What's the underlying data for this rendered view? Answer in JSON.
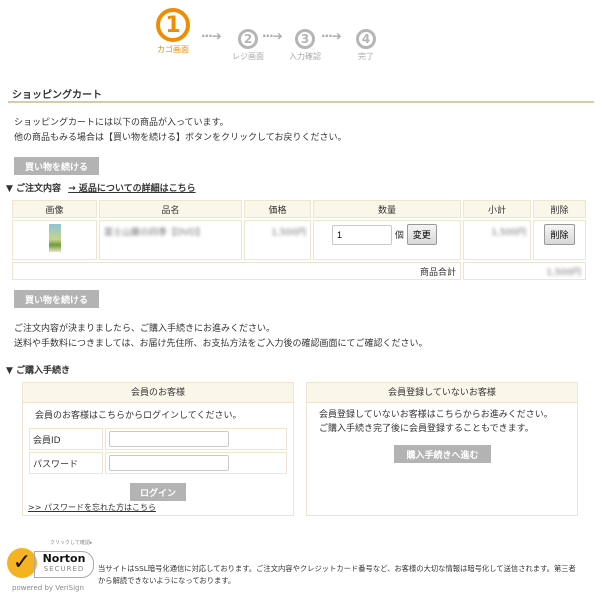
{
  "steps": [
    {
      "num": "1",
      "label": "カゴ画面",
      "active": true
    },
    {
      "num": "2",
      "label": "レジ画面"
    },
    {
      "num": "3",
      "label": "入力確認"
    },
    {
      "num": "4",
      "label": "完了"
    }
  ],
  "accent": "#f08c00",
  "page_title": "ショッピングカート",
  "intro": [
    "ショッピングカートには以下の商品が入っています。",
    "他の商品もみる場合は【買い物を続ける】ボタンをクリックしてお戻りください。"
  ],
  "continue_label": "買い物を続ける",
  "order": {
    "heading": "▼ ご注文内容",
    "return_link": "→ 返品についての詳細はこちら",
    "columns": [
      "画像",
      "品名",
      "価格",
      "数量",
      "小計",
      "削除"
    ],
    "items": [
      {
        "name": "富士山麓の四季【DVD】",
        "price": "1,500円",
        "quantity": "1",
        "unit": "個",
        "change_label": "変更",
        "subtotal": "1,500円",
        "delete_label": "削除"
      }
    ],
    "total_label": "商品合計",
    "total": "1,500円"
  },
  "notes": [
    "ご注文内容が決まりましたら、ご購入手続きにお進みください。",
    "送料や手数料につきましては、お届け先住所、お支払方法をご入力後の確認画面にてご確認ください。"
  ],
  "purchase": {
    "heading": "▼ ご購入手続き",
    "member": {
      "title": "会員のお客様",
      "text": "会員のお客様はこちらからログインしてください。",
      "id_label": "会員ID",
      "password_label": "パスワード",
      "login_label": "ログイン",
      "forgot_link": ">> パスワードを忘れた方はこちら"
    },
    "guest": {
      "title": "会員登録していないお客様",
      "text": [
        "会員登録していないお客様はこちらからお進みください。",
        "ご購入手続き完了後に会員登録することもできます。"
      ],
      "proceed_label": "購入手続きへ進む"
    }
  },
  "footer": {
    "seal": {
      "top": "クリックして確認▸",
      "brand": "Norton",
      "secured": "SECURED",
      "powered": "powered by VeriSign"
    },
    "text": [
      "当サイトはSSL暗号化通信に対応しております。ご注文内容やクレジットカード番号など、お客様の大切な情報は暗号化して送信されます。第三者",
      "から解読できないようになっております。"
    ]
  }
}
